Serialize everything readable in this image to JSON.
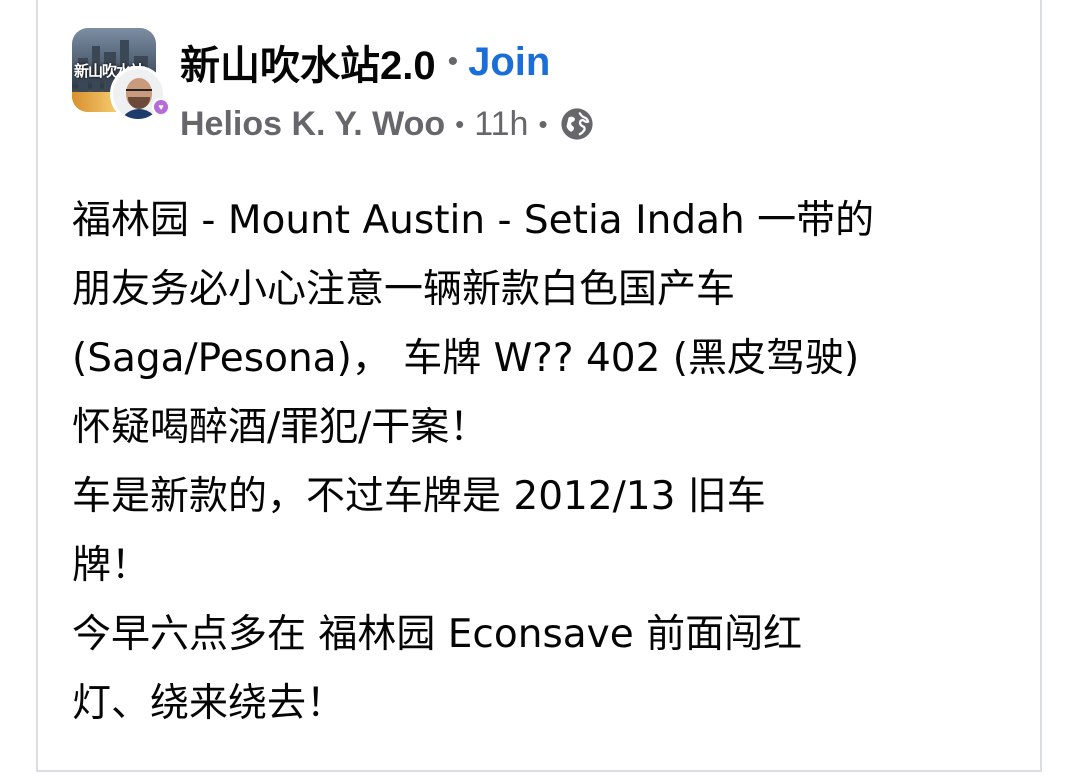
{
  "post": {
    "group_name": "新山吹水站2.0",
    "separator": "•",
    "join_label": "Join",
    "author": "Helios K. Y. Woo",
    "time_ago": "11h",
    "privacy_icon": "globe-icon",
    "body_lines": [
      "福林园 - Mount Austin - Setia Indah 一带的",
      "朋友务必小心注意一辆新款白色国产车",
      "(Saga/Pesona)， 车牌 W?? 402 (黑皮驾驶)",
      "怀疑喝醉酒/罪犯/干案！",
      "车是新款的，不过车牌是 2012/13 旧车",
      "牌！",
      "今早六点多在 福林园 Econsave 前面闯红",
      "灯、绕来绕去！"
    ]
  },
  "avatars": {
    "group_logo_text": "新山吹水站",
    "group_avatar_icon": "group-avatar",
    "user_avatar_icon": "user-avatar"
  },
  "colors": {
    "primary_text": "#050505",
    "secondary_text": "#65676b",
    "link_blue": "#1a6ed8",
    "border": "#dadde1",
    "badge": "#b86bd8"
  }
}
